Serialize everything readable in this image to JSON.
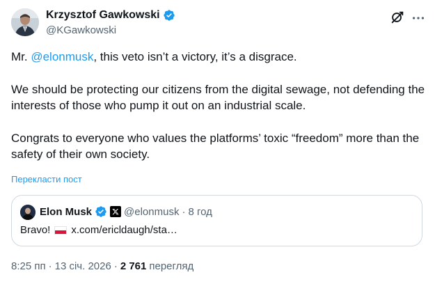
{
  "author": {
    "display_name": "Krzysztof Gawkowski",
    "handle": "@KGawkowski",
    "verified_color": "#1d9bf0"
  },
  "actions": {
    "grok_icon": "grok-icon",
    "more_icon": "more-options-icon"
  },
  "tweet": {
    "para1_prefix": "Mr. ",
    "para1_mention": "@elonmusk",
    "para1_suffix": ", this veto isn’t a victory, it’s a disgrace.",
    "para2": "We should be protecting our citizens from the digital sewage, not defending the interests of those who pump it out on an industrial scale.",
    "para3": "Congrats to everyone who values the platforms’ toxic “freedom” more than the safety of their own society.",
    "translate_label": "Перекласти пост"
  },
  "quote": {
    "display_name": "Elon Musk",
    "handle": "@elonmusk",
    "separator": "·",
    "time": "8 год",
    "text_prefix": "Bravo!",
    "flag": "poland-flag",
    "link_text": "x.com/ericldaugh/sta…"
  },
  "meta": {
    "time": "8:25 пп",
    "separator": "·",
    "date": "13 січ. 2026",
    "views_count": "2 761",
    "views_label": "перегляд"
  },
  "colors": {
    "accent": "#1d9bf0",
    "text": "#0f1419",
    "secondary": "#536471",
    "border": "#cfd9de"
  }
}
